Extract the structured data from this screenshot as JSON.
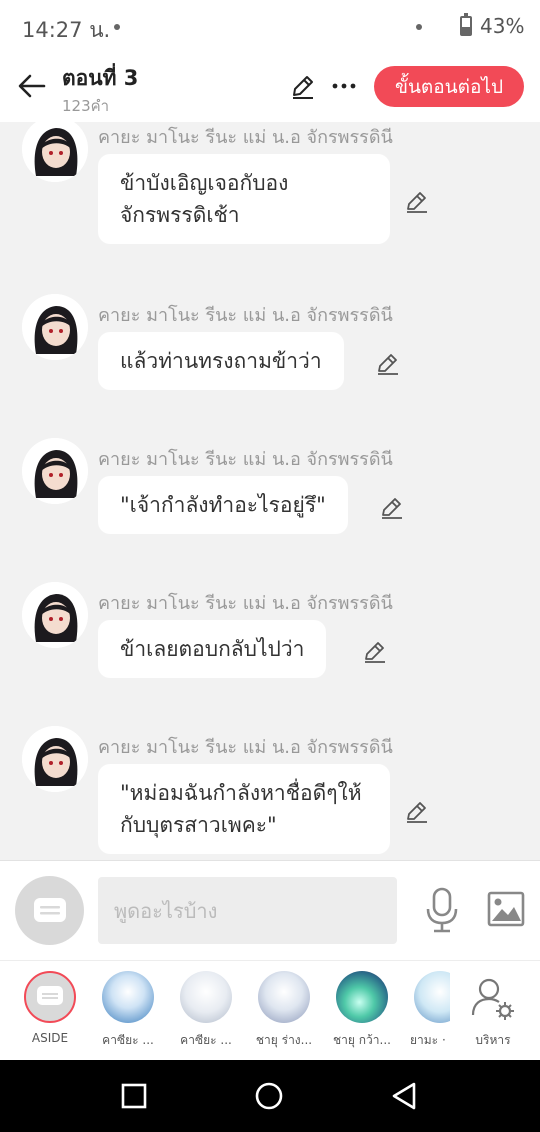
{
  "status_bar": {
    "time": "14:27 น.",
    "battery_percent": "43%",
    "battery_level": 0.43
  },
  "header": {
    "title": "ตอนที่ 3",
    "word_count": "123คำ",
    "next_label": "ขั้นตอนต่อไป"
  },
  "messages": [
    {
      "sender": "คายะ มาโนะ รีนะ แม่ น.อ จักรพรรดินี",
      "text": "ข้าบังเอิญเจอกับองจักรพรรดิเช้า"
    },
    {
      "sender": "คายะ มาโนะ รีนะ แม่ น.อ จักรพรรดินี",
      "text": "แล้วท่านทรงถามข้าว่า"
    },
    {
      "sender": "คายะ มาโนะ รีนะ แม่ น.อ จักรพรรดินี",
      "text": "\"เจ้ากำลังทำอะไรอยู่รึ\""
    },
    {
      "sender": "คายะ มาโนะ รีนะ แม่ น.อ จักรพรรดินี",
      "text": "ข้าเลยตอบกลับไปว่า"
    },
    {
      "sender": "คายะ มาโนะ รีนะ แม่ น.อ จักรพรรดินี",
      "text": "\"หม่อมฉันกำลังหาชื่อดีๆให้กับบุตรสาวเพคะ\""
    }
  ],
  "input": {
    "placeholder": "พูดอะไรบ้าง"
  },
  "characters": [
    {
      "label": "ASIDE"
    },
    {
      "label": "คาซียะ ..."
    },
    {
      "label": "คาซียะ ..."
    },
    {
      "label": "ชายุ ร่าง..."
    },
    {
      "label": "ชายุ กว้า..."
    },
    {
      "label": "ยามะ ·"
    },
    {
      "label": "บริหาร"
    }
  ],
  "colors": {
    "accent": "#f24a57",
    "background": "#f2f2f2",
    "bubble": "#ffffff"
  }
}
